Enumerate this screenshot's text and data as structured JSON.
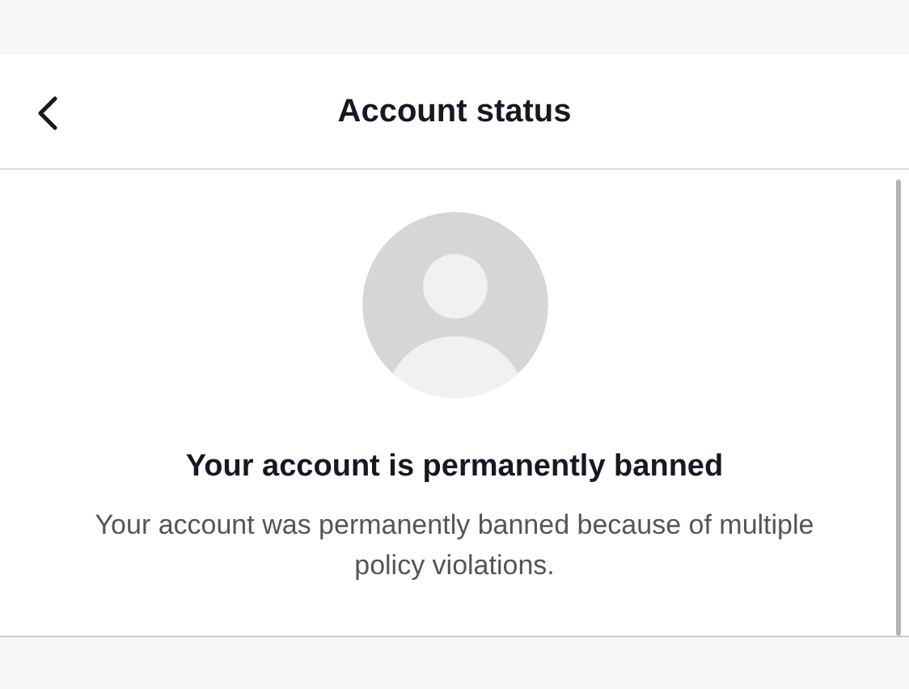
{
  "header": {
    "title": "Account status"
  },
  "message": {
    "heading": "Your account is permanently banned",
    "body": "Your account was permanently banned because of multiple policy violations."
  }
}
